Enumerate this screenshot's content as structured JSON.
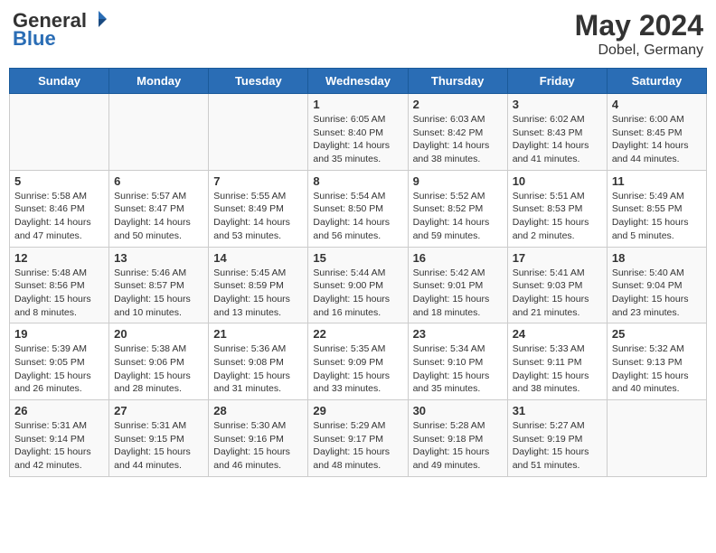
{
  "header": {
    "logo_general": "General",
    "logo_blue": "Blue",
    "month_year": "May 2024",
    "location": "Dobel, Germany"
  },
  "weekdays": [
    "Sunday",
    "Monday",
    "Tuesday",
    "Wednesday",
    "Thursday",
    "Friday",
    "Saturday"
  ],
  "weeks": [
    [
      {
        "day": "",
        "info": ""
      },
      {
        "day": "",
        "info": ""
      },
      {
        "day": "",
        "info": ""
      },
      {
        "day": "1",
        "info": "Sunrise: 6:05 AM\nSunset: 8:40 PM\nDaylight: 14 hours\nand 35 minutes."
      },
      {
        "day": "2",
        "info": "Sunrise: 6:03 AM\nSunset: 8:42 PM\nDaylight: 14 hours\nand 38 minutes."
      },
      {
        "day": "3",
        "info": "Sunrise: 6:02 AM\nSunset: 8:43 PM\nDaylight: 14 hours\nand 41 minutes."
      },
      {
        "day": "4",
        "info": "Sunrise: 6:00 AM\nSunset: 8:45 PM\nDaylight: 14 hours\nand 44 minutes."
      }
    ],
    [
      {
        "day": "5",
        "info": "Sunrise: 5:58 AM\nSunset: 8:46 PM\nDaylight: 14 hours\nand 47 minutes."
      },
      {
        "day": "6",
        "info": "Sunrise: 5:57 AM\nSunset: 8:47 PM\nDaylight: 14 hours\nand 50 minutes."
      },
      {
        "day": "7",
        "info": "Sunrise: 5:55 AM\nSunset: 8:49 PM\nDaylight: 14 hours\nand 53 minutes."
      },
      {
        "day": "8",
        "info": "Sunrise: 5:54 AM\nSunset: 8:50 PM\nDaylight: 14 hours\nand 56 minutes."
      },
      {
        "day": "9",
        "info": "Sunrise: 5:52 AM\nSunset: 8:52 PM\nDaylight: 14 hours\nand 59 minutes."
      },
      {
        "day": "10",
        "info": "Sunrise: 5:51 AM\nSunset: 8:53 PM\nDaylight: 15 hours\nand 2 minutes."
      },
      {
        "day": "11",
        "info": "Sunrise: 5:49 AM\nSunset: 8:55 PM\nDaylight: 15 hours\nand 5 minutes."
      }
    ],
    [
      {
        "day": "12",
        "info": "Sunrise: 5:48 AM\nSunset: 8:56 PM\nDaylight: 15 hours\nand 8 minutes."
      },
      {
        "day": "13",
        "info": "Sunrise: 5:46 AM\nSunset: 8:57 PM\nDaylight: 15 hours\nand 10 minutes."
      },
      {
        "day": "14",
        "info": "Sunrise: 5:45 AM\nSunset: 8:59 PM\nDaylight: 15 hours\nand 13 minutes."
      },
      {
        "day": "15",
        "info": "Sunrise: 5:44 AM\nSunset: 9:00 PM\nDaylight: 15 hours\nand 16 minutes."
      },
      {
        "day": "16",
        "info": "Sunrise: 5:42 AM\nSunset: 9:01 PM\nDaylight: 15 hours\nand 18 minutes."
      },
      {
        "day": "17",
        "info": "Sunrise: 5:41 AM\nSunset: 9:03 PM\nDaylight: 15 hours\nand 21 minutes."
      },
      {
        "day": "18",
        "info": "Sunrise: 5:40 AM\nSunset: 9:04 PM\nDaylight: 15 hours\nand 23 minutes."
      }
    ],
    [
      {
        "day": "19",
        "info": "Sunrise: 5:39 AM\nSunset: 9:05 PM\nDaylight: 15 hours\nand 26 minutes."
      },
      {
        "day": "20",
        "info": "Sunrise: 5:38 AM\nSunset: 9:06 PM\nDaylight: 15 hours\nand 28 minutes."
      },
      {
        "day": "21",
        "info": "Sunrise: 5:36 AM\nSunset: 9:08 PM\nDaylight: 15 hours\nand 31 minutes."
      },
      {
        "day": "22",
        "info": "Sunrise: 5:35 AM\nSunset: 9:09 PM\nDaylight: 15 hours\nand 33 minutes."
      },
      {
        "day": "23",
        "info": "Sunrise: 5:34 AM\nSunset: 9:10 PM\nDaylight: 15 hours\nand 35 minutes."
      },
      {
        "day": "24",
        "info": "Sunrise: 5:33 AM\nSunset: 9:11 PM\nDaylight: 15 hours\nand 38 minutes."
      },
      {
        "day": "25",
        "info": "Sunrise: 5:32 AM\nSunset: 9:13 PM\nDaylight: 15 hours\nand 40 minutes."
      }
    ],
    [
      {
        "day": "26",
        "info": "Sunrise: 5:31 AM\nSunset: 9:14 PM\nDaylight: 15 hours\nand 42 minutes."
      },
      {
        "day": "27",
        "info": "Sunrise: 5:31 AM\nSunset: 9:15 PM\nDaylight: 15 hours\nand 44 minutes."
      },
      {
        "day": "28",
        "info": "Sunrise: 5:30 AM\nSunset: 9:16 PM\nDaylight: 15 hours\nand 46 minutes."
      },
      {
        "day": "29",
        "info": "Sunrise: 5:29 AM\nSunset: 9:17 PM\nDaylight: 15 hours\nand 48 minutes."
      },
      {
        "day": "30",
        "info": "Sunrise: 5:28 AM\nSunset: 9:18 PM\nDaylight: 15 hours\nand 49 minutes."
      },
      {
        "day": "31",
        "info": "Sunrise: 5:27 AM\nSunset: 9:19 PM\nDaylight: 15 hours\nand 51 minutes."
      },
      {
        "day": "",
        "info": ""
      }
    ]
  ]
}
